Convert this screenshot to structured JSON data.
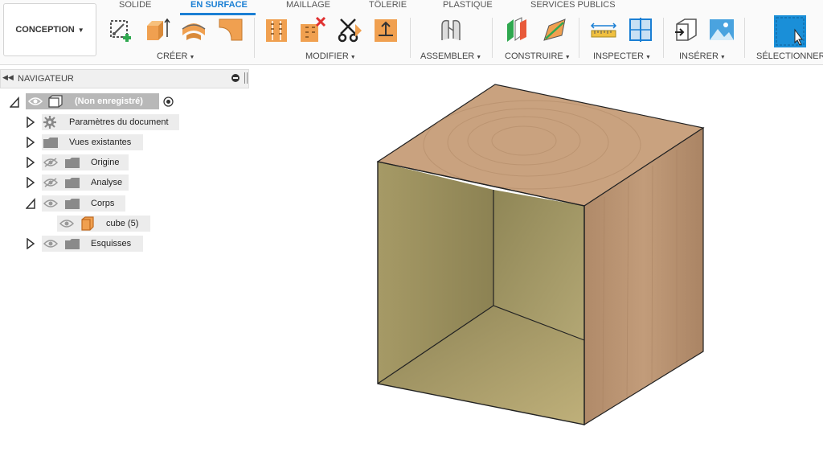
{
  "workspace": {
    "label": "CONCEPTION"
  },
  "tabs": [
    "SOLIDE",
    "EN SURFACE",
    "MAILLAGE",
    "TÔLERIE",
    "PLASTIQUE",
    "SERVICES PUBLICS"
  ],
  "groups": {
    "create": "CRÉER",
    "modify": "MODIFIER",
    "assemble": "ASSEMBLER",
    "construct": "CONSTRUIRE",
    "inspect": "INSPECTER",
    "insert": "INSÉRER",
    "select": "SÉLECTIONNER"
  },
  "navigator": {
    "title": "NAVIGATEUR",
    "root": "(Non enregistré)",
    "items": [
      {
        "label": "Paramètres du document"
      },
      {
        "label": "Vues existantes"
      },
      {
        "label": "Origine"
      },
      {
        "label": "Analyse"
      },
      {
        "label": "Corps"
      },
      {
        "label": "cube (5)"
      },
      {
        "label": "Esquisses"
      }
    ]
  },
  "colors": {
    "accent": "#1b7fd4",
    "tool_orange": "#f0a050",
    "select_blue": "#1a8fd8",
    "wood_top": "#c9a27f",
    "wood_side": "#b58e6d",
    "inner_surface": "#9f9462"
  },
  "icons": [
    "sketch-icon",
    "extrude-icon",
    "revolve-icon",
    "patch-icon",
    "stitch-icon",
    "unstitch-icon",
    "trim-icon",
    "offset-icon",
    "joint-icon",
    "plane-icon",
    "axis-icon",
    "measure-icon",
    "section-icon",
    "insert-icon",
    "decal-icon",
    "select-icon",
    "eye-icon",
    "gear-icon",
    "folder-icon",
    "body-icon"
  ]
}
